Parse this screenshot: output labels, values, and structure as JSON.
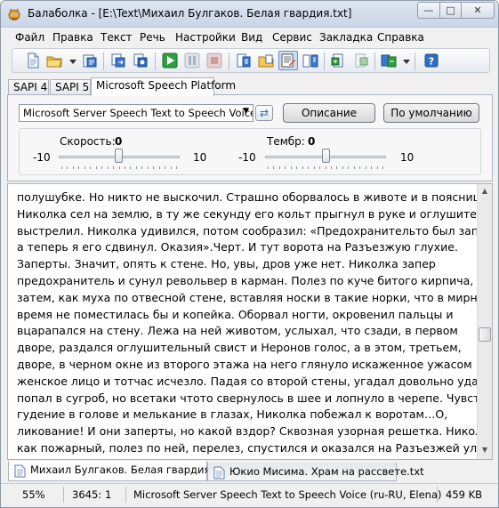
{
  "window": {
    "title": "Балаболка - [E:\\Text\\Михаил Булгаков. Белая гвардия.txt]",
    "minimize_glyph": "—",
    "maximize_glyph": "□",
    "close_glyph": "✕"
  },
  "menu": [
    "Файл",
    "Правка",
    "Текст",
    "Речь",
    "Настройки",
    "Вид",
    "Сервис",
    "Закладка",
    "Справка"
  ],
  "toolbar": {
    "icons": [
      "new-document-icon",
      "open-folder-icon",
      "open-dropdown-icon",
      "save-audio-icon",
      "export-icon",
      "convert-icon",
      "play-icon",
      "pause-icon",
      "stop-icon",
      "read-clipboard-icon",
      "folder-text-icon",
      "edit-text-icon",
      "dictionary-icon",
      "speak-file-icon",
      "split-file-icon",
      "batch-convert-icon",
      "options-dropdown-icon",
      "help-icon"
    ],
    "accent": "#2f6fbd"
  },
  "sapi_tabs": [
    "SAPI 4",
    "SAPI 5",
    "Microsoft Speech Platform"
  ],
  "voice_panel": {
    "selected_voice": "Microsoft Server Speech Text to Speech Voice (ru",
    "refresh_glyph": "⇄",
    "description_button": "Описание",
    "default_button": "По умолчанию",
    "rate": {
      "label": "Скорость:",
      "value": "0",
      "min": "-10",
      "max": "10",
      "level": 0
    },
    "pitch": {
      "label": "Тембр:",
      "value": "0",
      "min": "-10",
      "max": "10",
      "level": 0
    }
  },
  "text": [
    "полушубке. Но никто не выскочил. Страшно оборвалось в животе и в пояснице, и",
    "Николка сел на землю, в ту же секунду его кольт прыгнул в руке и оглушительно",
    "выстрелил. Николка удивился, потом сообразил: «Предохранительто был заперт,",
    "а теперь я его сдвинул. Оказия».Черт. И тут ворота на Разъезжую глухие.",
    "Заперты. Значит, опять к стене. Но, увы, дров уже нет. Николка запер",
    "предохранитель и сунул револьвер в карман. Полез по куче битого кирпича, а",
    "затем, как муха по отвесной стене, вставляя носки в такие норки, что в мирное",
    "время не поместилась бы и копейка. Оборвал ногти, окровенил пальцы и",
    "вцарапался на стену. Лежа на ней животом, услыхал, что сзади, в первом",
    "дворе, раздался оглушительный свист и Неронов голос, а в этом, третьем,",
    "дворе, в черном окне из второго этажа на него глянуло искаженное ужасом",
    "женское лицо и тотчас исчезло. Падая со второй стены, угадал довольно удачно:",
    "попал в сугроб, но всетаки чтото свернулось в шее и лопнуло в черепе. Чувствуя",
    "гудение в голове и мелькание в глазах, Николка побежал к воротам…О,",
    "ликование! И они заперты, но какой вздор? Сквозная узорная решетка. Николка,",
    "как пожарный, полез по ней, перелез, спустился и оказался на Разъезжей улице."
  ],
  "doc_tabs": [
    "Михаил Булгаков. Белая гвардия.txt",
    "Юкио Мисима. Храм на рассвете.txt"
  ],
  "status": {
    "zoom": "55%",
    "position": "3645:",
    "line": "1",
    "voice": "Microsoft Server Speech Text to Speech Voice (ru-RU, Elena)",
    "size": "459 KB"
  },
  "scrollbar": {
    "up_glyph": "▲",
    "down_glyph": "▼",
    "position": 0.55
  }
}
